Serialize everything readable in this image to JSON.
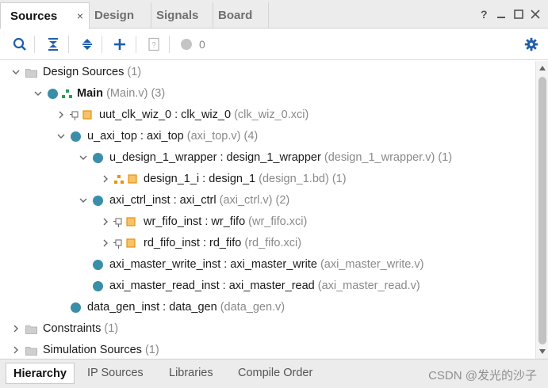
{
  "tabs": [
    {
      "label": "Sources",
      "active": true
    },
    {
      "label": "Design",
      "active": false
    },
    {
      "label": "Signals",
      "active": false
    },
    {
      "label": "Board",
      "active": false
    }
  ],
  "tab_close": "×",
  "window_controls": {
    "help": "?",
    "minimize": "–",
    "restore": "□",
    "close": "×"
  },
  "toolbar": {
    "messages_count": "0"
  },
  "tree": {
    "design_sources": {
      "label": "Design Sources",
      "meta": "(1)"
    },
    "main": {
      "label": "Main",
      "meta": "(Main.v) (3)"
    },
    "uut_clk_wiz_0": {
      "label": "uut_clk_wiz_0 : clk_wiz_0",
      "meta": "(clk_wiz_0.xci)"
    },
    "u_axi_top": {
      "label": "u_axi_top : axi_top",
      "meta": "(axi_top.v) (4)"
    },
    "u_design_1_wrapper": {
      "label": "u_design_1_wrapper : design_1_wrapper",
      "meta": "(design_1_wrapper.v) (1)"
    },
    "design_1_i": {
      "label": "design_1_i : design_1",
      "meta": "(design_1.bd) (1)"
    },
    "axi_ctrl_inst": {
      "label": "axi_ctrl_inst : axi_ctrl",
      "meta": "(axi_ctrl.v) (2)"
    },
    "wr_fifo_inst": {
      "label": "wr_fifo_inst : wr_fifo",
      "meta": "(wr_fifo.xci)"
    },
    "rd_fifo_inst": {
      "label": "rd_fifo_inst : rd_fifo",
      "meta": "(rd_fifo.xci)"
    },
    "axi_master_write_inst": {
      "label": "axi_master_write_inst : axi_master_write",
      "meta": "(axi_master_write.v)"
    },
    "axi_master_read_inst": {
      "label": "axi_master_read_inst : axi_master_read",
      "meta": "(axi_master_read.v)"
    },
    "data_gen_inst": {
      "label": "data_gen_inst : data_gen",
      "meta": "(data_gen.v)"
    },
    "constraints": {
      "label": "Constraints",
      "meta": "(1)"
    },
    "simulation_sources": {
      "label": "Simulation Sources",
      "meta": "(1)"
    }
  },
  "bottom_tabs": [
    {
      "label": "Hierarchy",
      "active": true
    },
    {
      "label": "IP Sources",
      "active": false
    },
    {
      "label": "Libraries",
      "active": false
    },
    {
      "label": "Compile Order",
      "active": false
    }
  ],
  "watermark": "CSDN @发光的沙子",
  "colors": {
    "accent_blue": "#1f5fa8",
    "module_dot": "#3a8ea8",
    "ip_orange": "#e8920a"
  }
}
